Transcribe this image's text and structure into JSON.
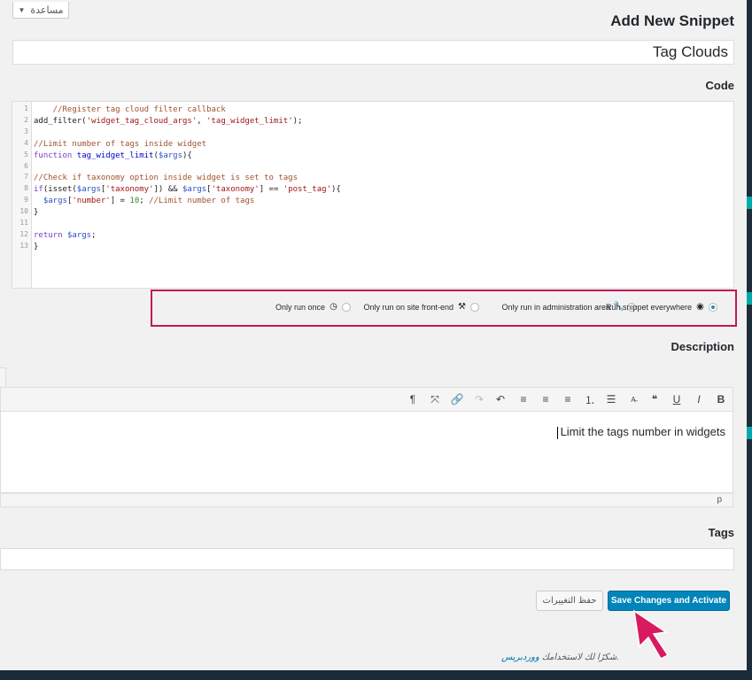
{
  "help_tab": {
    "label": "مساعدة"
  },
  "page": {
    "title": "Add New Snippet"
  },
  "snippet": {
    "name": "Tag Clouds"
  },
  "code_section": {
    "label": "Code",
    "line_numbers": [
      "1",
      "2",
      "3",
      "4",
      "5",
      "6",
      "7",
      "8",
      "9",
      "10",
      "11",
      "12",
      "13"
    ],
    "lines": [
      [
        [
          "cm",
          "    //Register tag cloud filter callback"
        ]
      ],
      [
        [
          "plain",
          "add_filter("
        ],
        [
          "str",
          "'widget_tag_cloud_args'"
        ],
        [
          "plain",
          ", "
        ],
        [
          "str",
          "'tag_widget_limit'"
        ],
        [
          "plain",
          ");"
        ]
      ],
      [],
      [
        [
          "cm",
          "//Limit number of tags inside widget"
        ]
      ],
      [
        [
          "kw",
          "function "
        ],
        [
          "fn",
          "tag_widget_limit"
        ],
        [
          "plain",
          "("
        ],
        [
          "var",
          "$args"
        ],
        [
          "plain",
          "){"
        ]
      ],
      [],
      [
        [
          "cm",
          "//Check if taxonomy option inside widget is set to tags"
        ]
      ],
      [
        [
          "kw",
          "if"
        ],
        [
          "plain",
          "(isset("
        ],
        [
          "var",
          "$args"
        ],
        [
          "plain",
          "["
        ],
        [
          "str",
          "'taxonomy'"
        ],
        [
          "plain",
          "]) && "
        ],
        [
          "var",
          "$args"
        ],
        [
          "plain",
          "["
        ],
        [
          "str",
          "'taxonomy'"
        ],
        [
          "plain",
          "] == "
        ],
        [
          "str",
          "'post_tag'"
        ],
        [
          "plain",
          "){"
        ]
      ],
      [
        [
          "plain",
          "  "
        ],
        [
          "var",
          "$args"
        ],
        [
          "plain",
          "["
        ],
        [
          "str",
          "'number'"
        ],
        [
          "plain",
          "] = "
        ],
        [
          "num",
          "10"
        ],
        [
          "plain",
          "; "
        ],
        [
          "cm",
          "//Limit number of tags"
        ]
      ],
      [
        [
          "plain",
          "}"
        ]
      ],
      [],
      [
        [
          "kw",
          "return "
        ],
        [
          "var",
          "$args"
        ],
        [
          "plain",
          ";"
        ]
      ],
      [
        [
          "plain",
          "}"
        ]
      ]
    ]
  },
  "scope_options": [
    {
      "label": "Only run once",
      "icon": "clock-icon",
      "selected": false
    },
    {
      "label": "Only run on site front-end",
      "icon": "hammer-icon",
      "selected": false
    },
    {
      "label": "Only run in administration area",
      "icon": "wrench-icon",
      "selected": false
    },
    {
      "label": "Run snippet everywhere",
      "icon": "globe-icon",
      "selected": true
    }
  ],
  "description": {
    "label": "Description",
    "content": "Limit the tags number in widgets",
    "status_path": "p",
    "toolbar": [
      "paragraph-icon",
      "fullscreen-icon",
      "link-icon",
      "redo-icon",
      "undo-icon",
      "align-right-icon",
      "align-center-icon",
      "align-left-icon",
      "ordered-list-icon",
      "unordered-list-icon",
      "strikethrough-icon",
      "blockquote-icon",
      "underline-icon",
      "italic-icon",
      "bold-icon"
    ]
  },
  "tags": {
    "label": "Tags",
    "value": ""
  },
  "actions": {
    "save_label": "حفظ التغييرات",
    "save_activate_label": "Save Changes and Activate"
  },
  "footer": {
    "thanks_text": "شكرًا لك لاستخدامك ",
    "wp_link": "ووردبريس."
  },
  "colors": {
    "accent": "#0085ba",
    "highlight_box": "#c2185b"
  }
}
